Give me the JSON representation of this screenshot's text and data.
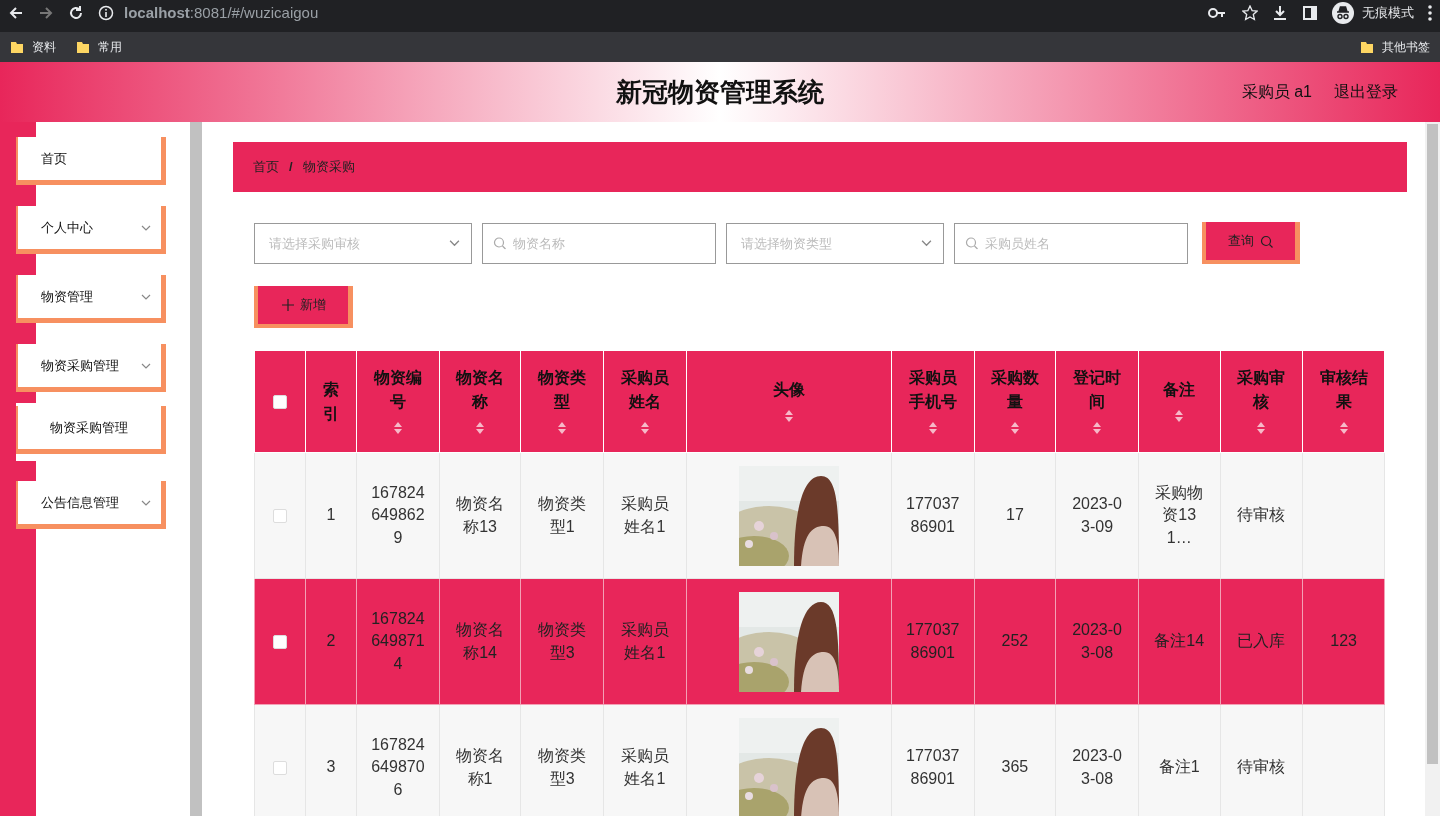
{
  "browser": {
    "url": "**localhost**:8081/#/wuzicaigou",
    "profile": "无痕模式",
    "bookmarks": [
      "资料",
      "常用"
    ],
    "other_bookmarks": "其他书签"
  },
  "header": {
    "title": "新冠物资管理系统",
    "user": "采购员 a1",
    "logout": "退出登录"
  },
  "sidebar": {
    "items": [
      {
        "label": "首页",
        "kind": "link"
      },
      {
        "label": "个人中心",
        "kind": "menu"
      },
      {
        "label": "物资管理",
        "kind": "menu"
      },
      {
        "label": "物资采购管理",
        "kind": "menu",
        "children": [
          {
            "label": "物资采购管理"
          }
        ]
      },
      {
        "label": "公告信息管理",
        "kind": "menu"
      }
    ]
  },
  "breadcrumb": {
    "items": [
      "首页",
      "物资采购"
    ],
    "separator": "/"
  },
  "filters": [
    {
      "kind": "select",
      "placeholder": "请选择采购审核"
    },
    {
      "kind": "search",
      "placeholder": "物资名称"
    },
    {
      "kind": "select",
      "placeholder": "请选择物资类型"
    },
    {
      "kind": "search",
      "placeholder": "采购员姓名"
    }
  ],
  "query_button": "查询",
  "add_button": "新增",
  "table": {
    "select_all_checked": false,
    "columns": [
      {
        "label": "索引",
        "sortable": false
      },
      {
        "label": "物资编号",
        "sortable": true
      },
      {
        "label": "物资名称",
        "sortable": true
      },
      {
        "label": "物资类型",
        "sortable": true
      },
      {
        "label": "采购员姓名",
        "sortable": true
      },
      {
        "label": "头像",
        "sortable": true
      },
      {
        "label": "采购员手机号",
        "sortable": true
      },
      {
        "label": "采购数量",
        "sortable": true
      },
      {
        "label": "登记时间",
        "sortable": true
      },
      {
        "label": "备注",
        "sortable": true
      },
      {
        "label": "采购审核",
        "sortable": true
      },
      {
        "label": "审核结果",
        "sortable": true
      }
    ],
    "rows": [
      {
        "checked": false,
        "hovered": false,
        "cells": [
          "1",
          "1678246498629",
          "物资名称13",
          "物资类型1",
          "采购员姓名1",
          {
            "kind": "picture"
          },
          "17703786901",
          "17",
          "2023-03-09",
          "采购物资131…",
          "待审核",
          null
        ]
      },
      {
        "checked": false,
        "hovered": true,
        "cells": [
          "2",
          "1678246498714",
          "物资名称14",
          "物资类型3",
          "采购员姓名1",
          {
            "kind": "picture"
          },
          "17703786901",
          "252",
          "2023-03-08",
          "备注14",
          "已入库",
          "123"
        ]
      },
      {
        "checked": false,
        "hovered": false,
        "cells": [
          "3",
          "1678246498706",
          "物资名称1",
          "物资类型3",
          "采购员姓名1",
          {
            "kind": "picture"
          },
          "17703786901",
          "365",
          "2023-03-08",
          "备注1",
          "待审核",
          null
        ]
      }
    ]
  }
}
